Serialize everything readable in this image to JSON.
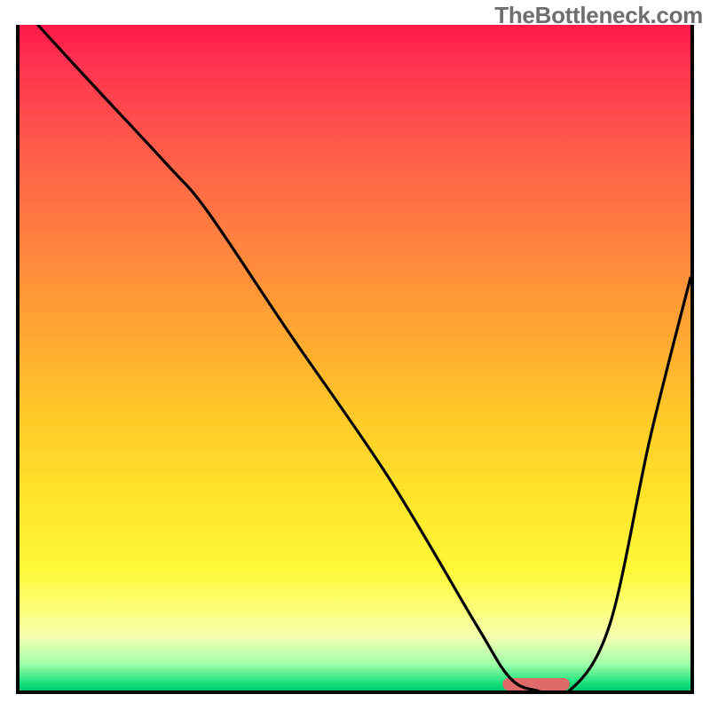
{
  "watermark": "TheBottleneck.com",
  "chart_data": {
    "type": "line",
    "title": "",
    "xlabel": "",
    "ylabel": "",
    "xlim": [
      0,
      100
    ],
    "ylim": [
      0,
      100
    ],
    "grid": false,
    "legend": false,
    "series": [
      {
        "name": "bottleneck-curve",
        "x": [
          0,
          10,
          22,
          28,
          40,
          55,
          68,
          73,
          77,
          82,
          88,
          94,
          100
        ],
        "y": [
          103,
          92,
          79,
          72,
          54,
          32,
          10,
          2,
          0,
          0,
          10,
          38,
          62
        ]
      }
    ],
    "marker": {
      "name": "optimum-marker",
      "x_start": 72,
      "x_end": 82,
      "y": 0
    },
    "gradient_stops": [
      {
        "pos": 0,
        "color": "#ff1a4a"
      },
      {
        "pos": 18,
        "color": "#ff5a4a"
      },
      {
        "pos": 46,
        "color": "#ffa631"
      },
      {
        "pos": 72,
        "color": "#ffe62a"
      },
      {
        "pos": 92,
        "color": "#f4ffb2"
      },
      {
        "pos": 100,
        "color": "#00c86a"
      }
    ]
  }
}
